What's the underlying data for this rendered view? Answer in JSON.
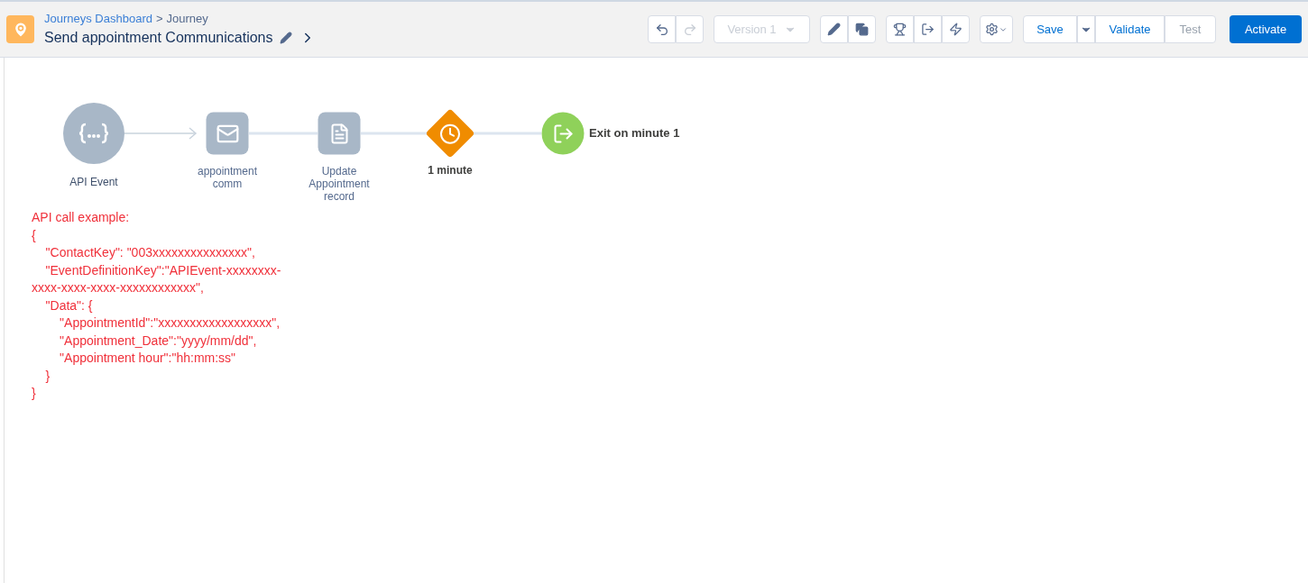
{
  "header": {
    "breadcrumb": {
      "link": "Journeys Dashboard",
      "separator": ">",
      "current": "Journey"
    },
    "title": "Send appointment Communications"
  },
  "toolbar": {
    "undo": {
      "disabled": false
    },
    "redo": {
      "disabled": true
    },
    "version": {
      "label": "Version 1",
      "disabled": true
    },
    "actions": [
      {
        "label": "Save",
        "disabled": false
      },
      {
        "label": "Validate",
        "disabled": false
      },
      {
        "label": "Test",
        "disabled": true
      }
    ],
    "activate": "Activate"
  },
  "nodes": [
    {
      "kind": "event",
      "label": "API Event"
    },
    {
      "kind": "email",
      "label": "appointment comm"
    },
    {
      "kind": "update",
      "label": "Update Appointment record"
    },
    {
      "kind": "wait",
      "label": "1 minute"
    },
    {
      "kind": "exit",
      "label": "Exit on minute 1"
    }
  ],
  "note": [
    "API call example:",
    "{",
    "    \"ContactKey\": \"003xxxxxxxxxxxxxxx\",",
    "    \"EventDefinitionKey\":\"APIEvent-xxxxxxxx-",
    "xxxx-xxxx-xxxx-xxxxxxxxxxxx\",",
    "    \"Data\": {",
    "        \"AppointmentId\":\"xxxxxxxxxxxxxxxxxx\",",
    "        \"Appointment_Date\":\"yyyy/mm/dd\",",
    "        \"Appointment hour\":\"hh:mm:ss\"",
    "    }",
    "}"
  ]
}
